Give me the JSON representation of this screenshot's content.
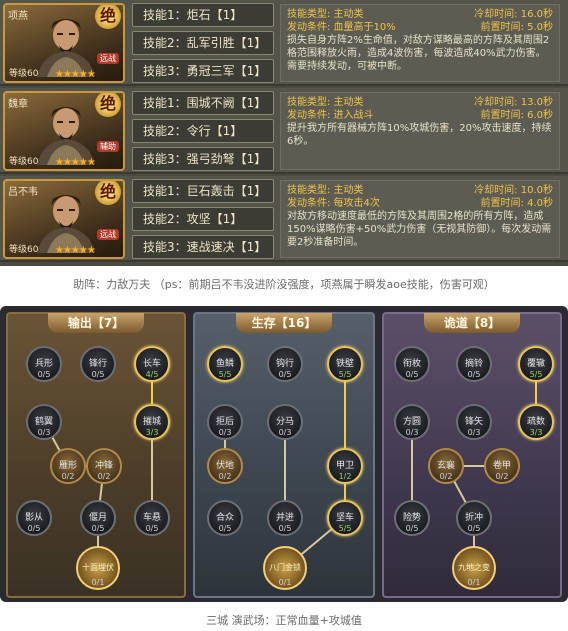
{
  "heroes": [
    {
      "name": "项燕",
      "badge": "绝",
      "type": "远战",
      "level": "等级60",
      "stars": "★★★★★",
      "skills": [
        "技能1：炬石【1】",
        "技能2：乱军引胜【1】",
        "技能3：勇冠三军【1】"
      ],
      "detail": {
        "type_label": "技能类型: 主动类",
        "cd_label": "冷却时间: 16.0秒",
        "cond_label": "发动条件: 血量高于10%",
        "pre_label": "前置时间: 5.0秒",
        "text": "损失自身方阵2%生命值，对敌方谋略最高的方阵及其周围2格范围释放火雨，造成4波伤害，每波造成40%武力伤害。需要持续发动，可被中断。"
      }
    },
    {
      "name": "魏章",
      "badge": "绝",
      "type": "辅助",
      "level": "等级60",
      "stars": "★★★★★",
      "skills": [
        "技能1：围城不阙【1】",
        "技能2：令行【1】",
        "技能3：强弓劲弩【1】"
      ],
      "detail": {
        "type_label": "技能类型: 主动类",
        "cd_label": "冷却时间: 13.0秒",
        "cond_label": "发动条件: 进入战斗",
        "pre_label": "前置时间: 6.0秒",
        "text": "提升我方所有器械方阵10%攻城伤害，20%攻击速度，持续6秒。"
      }
    },
    {
      "name": "吕不韦",
      "badge": "绝",
      "type": "远战",
      "level": "等级60",
      "stars": "★★★★★",
      "skills": [
        "技能1：巨石轰击【1】",
        "技能2：攻坚【1】",
        "技能3：速战速决【1】"
      ],
      "detail": {
        "type_label": "技能类型: 主动类",
        "cd_label": "冷却时间: 10.0秒",
        "cond_label": "发动条件: 每攻击4次",
        "pre_label": "前置时间: 4.0秒",
        "text": "对敌方移动速度最低的方阵及其周围2格的所有方阵，造成150%谋略伤害+50%武力伤害（无视其防御）。每次发动需要2秒准备时间。"
      }
    }
  ],
  "caption_top": "助阵：力敌万夫 （ps：前期吕不韦没进阶没强度，项燕属于瞬发aoe技能，伤害可观）",
  "caption_bottom": "三城 演武场：正常血量+攻城值",
  "columns": [
    {
      "title": "输出【7】",
      "nodes": [
        {
          "label": "兵形",
          "count": "0/5"
        },
        {
          "label": "锋行",
          "count": "0/5"
        },
        {
          "label": "长车",
          "count": "4/5"
        },
        {
          "label": "鹤翼",
          "count": "0/3"
        },
        {
          "label": "摧城",
          "count": "3/3"
        },
        {
          "label": "雁形",
          "count": "0/2"
        },
        {
          "label": "冲锋",
          "count": "0/2"
        },
        {
          "label": "影从",
          "count": "0/5"
        },
        {
          "label": "偃月",
          "count": "0/5"
        },
        {
          "label": "车悬",
          "count": "0/5"
        },
        {
          "label": "十面埋伏",
          "count": "0/1"
        }
      ]
    },
    {
      "title": "生存【16】",
      "nodes": [
        {
          "label": "鱼鳞",
          "count": "5/5"
        },
        {
          "label": "钩行",
          "count": "0/5"
        },
        {
          "label": "铁壁",
          "count": "5/5"
        },
        {
          "label": "拒后",
          "count": "0/3"
        },
        {
          "label": "分马",
          "count": "0/3"
        },
        {
          "label": "伏地",
          "count": "0/2"
        },
        {
          "label": "甲卫",
          "count": "1/2"
        },
        {
          "label": "合众",
          "count": "0/5"
        },
        {
          "label": "并进",
          "count": "0/5"
        },
        {
          "label": "坚车",
          "count": "5/5"
        },
        {
          "label": "八门金锁",
          "count": "0/1"
        }
      ]
    },
    {
      "title": "诡道【8】",
      "nodes": [
        {
          "label": "衔枚",
          "count": "0/5"
        },
        {
          "label": "摘铃",
          "count": "0/5"
        },
        {
          "label": "覆辙",
          "count": "5/5"
        },
        {
          "label": "方圆",
          "count": "0/3"
        },
        {
          "label": "锋矢",
          "count": "0/3"
        },
        {
          "label": "疏数",
          "count": "3/3"
        },
        {
          "label": "玄襄",
          "count": "0/2"
        },
        {
          "label": "卷甲",
          "count": "0/2"
        },
        {
          "label": "险势",
          "count": "0/5"
        },
        {
          "label": "折冲",
          "count": "0/5"
        },
        {
          "label": "九地之变",
          "count": "0/1"
        }
      ]
    }
  ]
}
